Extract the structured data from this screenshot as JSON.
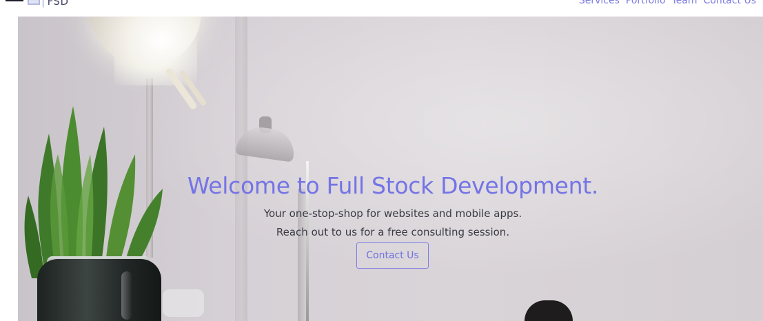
{
  "nav": {
    "brand": "FSD",
    "links": [
      "Services",
      "Portfolio",
      "Team",
      "Contact Us"
    ]
  },
  "hero": {
    "title": "Welcome to Full Stock Development.",
    "line1": "Your one-stop-shop for websites and mobile apps.",
    "line2": "Reach out to us for a free consulting session.",
    "cta_label": "Contact Us"
  },
  "colors": {
    "accent": "#7474e6",
    "body_text": "#3a3a44"
  }
}
